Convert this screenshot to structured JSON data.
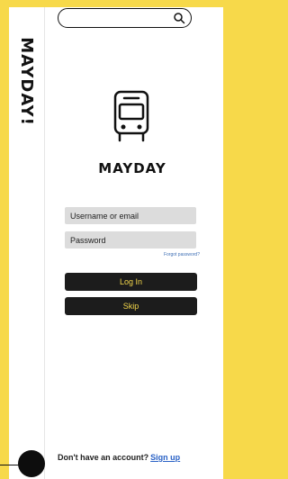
{
  "side": {
    "logo_text": "MAYDAY!"
  },
  "search": {
    "placeholder": ""
  },
  "brand": {
    "name": "MAYDAY"
  },
  "form": {
    "username_placeholder": "Username or email",
    "password_placeholder": "Password",
    "forgot_label": "Forgot password?",
    "login_label": "Log In",
    "skip_label": "Skip"
  },
  "footer": {
    "prompt_text": "Don't have an account?",
    "signup_label": "Sign up"
  },
  "colors": {
    "background": "#f7d94a",
    "button": "#1c1c1c",
    "button_text": "#f3d64a",
    "link": "#2a62c6"
  },
  "icons": [
    "search-icon",
    "bus-icon"
  ]
}
